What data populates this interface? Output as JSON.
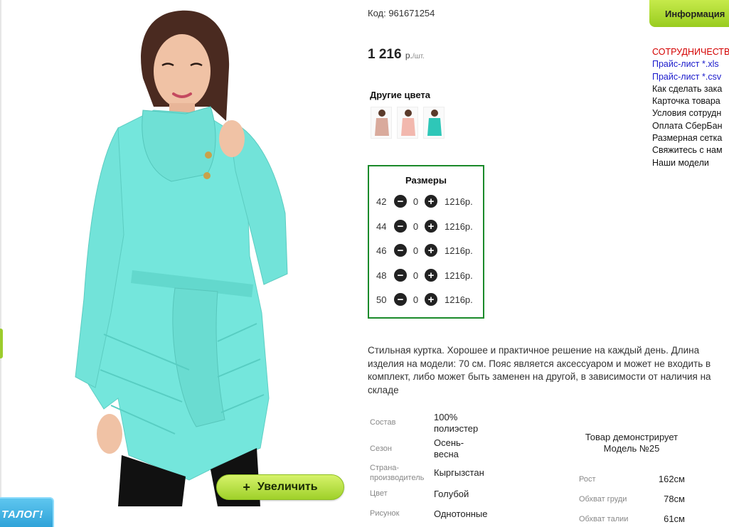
{
  "product": {
    "code": "Код: 961671254",
    "price": "1 216",
    "price_unit": "р.",
    "price_per": "/шт.",
    "other_colors_title": "Другие цвета",
    "swatches": [
      {
        "name": "beige-coat",
        "color": "#d9aa9c"
      },
      {
        "name": "pink-coat",
        "color": "#f2b8ae"
      },
      {
        "name": "turquoise-coat",
        "color": "#2ec7b8"
      }
    ],
    "zoom_label": "Увеличить",
    "zoom_plus": "+"
  },
  "catalog_badge": "ТАЛОГ!",
  "sizes": {
    "title": "Размеры",
    "rows": [
      {
        "size": "42",
        "qty": "0",
        "price": "1216р."
      },
      {
        "size": "44",
        "qty": "0",
        "price": "1216р."
      },
      {
        "size": "46",
        "qty": "0",
        "price": "1216р."
      },
      {
        "size": "48",
        "qty": "0",
        "price": "1216р."
      },
      {
        "size": "50",
        "qty": "0",
        "price": "1216р."
      }
    ],
    "minus": "−",
    "plus": "+"
  },
  "description": "Стильная куртка. Хорошее и практичное решение на каждый день. Длина изделия на модели: 70 см. Пояс является аксессуаром и может не входить в комплект, либо может быть заменен на другой, в зависимости от наличия на складе",
  "specs": [
    {
      "label": "Состав",
      "value": "100% полиэстер"
    },
    {
      "label": "Сезон",
      "value": "Осень-весна"
    },
    {
      "label": "Страна-производитель",
      "value": "Кыргызстан"
    },
    {
      "label": "Цвет",
      "value": "Голубой"
    },
    {
      "label": "Рисунок",
      "value": "Однотонные"
    }
  ],
  "model": {
    "title": "Товар демонстрирует Модель №25",
    "rows": [
      {
        "label": "Рост",
        "value": "162см"
      },
      {
        "label": "Обхват груди",
        "value": "78см"
      },
      {
        "label": "Обхват талии",
        "value": "61см"
      }
    ]
  },
  "sidebar": {
    "info_tab": "Информация",
    "links": [
      {
        "text": "СОТРУДНИЧЕСТВ",
        "color": "red"
      },
      {
        "text": "Прайс-лист *.xls",
        "color": "blue"
      },
      {
        "text": "Прайс-лист *.csv",
        "color": "blue"
      },
      {
        "text": "Как сделать зака",
        "color": "dark"
      },
      {
        "text": "Карточка товара",
        "color": "dark"
      },
      {
        "text": "Условия сотрудн",
        "color": "dark"
      },
      {
        "text": "Оплата СберБан",
        "color": "dark"
      },
      {
        "text": "Размерная сетка",
        "color": "dark"
      },
      {
        "text": "Свяжитесь с нам",
        "color": "dark"
      },
      {
        "text": "Наши модели",
        "color": "dark"
      }
    ]
  },
  "colors": {
    "coat": "#6fe3d8",
    "accent_green": "#9ccc2c",
    "sizes_border": "#1a8a2a"
  }
}
